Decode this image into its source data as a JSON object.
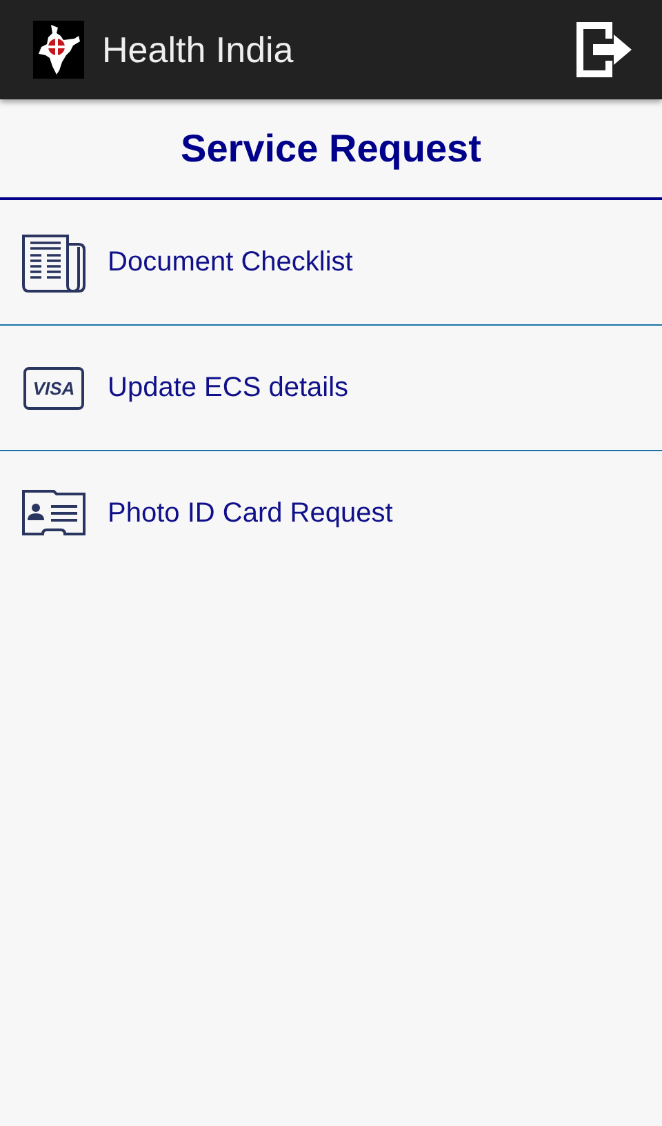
{
  "app_bar": {
    "title": "Health India"
  },
  "heading": "Service Request",
  "items": [
    {
      "kind": "document",
      "label": "Document Checklist"
    },
    {
      "kind": "card",
      "label": "Update ECS details",
      "card_text": "VISA"
    },
    {
      "kind": "id",
      "label": "Photo ID Card Request"
    }
  ]
}
